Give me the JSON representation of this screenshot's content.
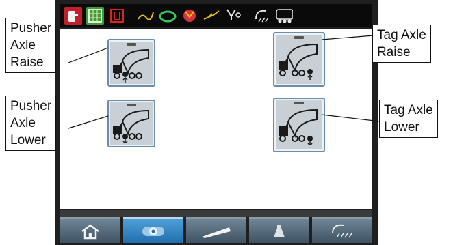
{
  "callouts": {
    "pusher_raise": [
      "Pusher",
      "Axle",
      "Raise"
    ],
    "pusher_lower": [
      "Pusher",
      "Axle",
      "Lower"
    ],
    "tag_raise": [
      "Tag Axle",
      "Raise"
    ],
    "tag_lower": [
      "Tag Axle",
      "Lower"
    ]
  },
  "topbar_icons": [
    "fuel-pump-icon",
    "grid-panel-icon",
    "tank-warning-icon",
    "drum-rotate-icon",
    "chute-icon",
    "valve-icon",
    "boom-icon",
    "water-valve-icon",
    "light-icon",
    "axle-status-icon"
  ],
  "bottom_tabs": [
    {
      "name": "home-icon",
      "active": false
    },
    {
      "name": "axle-icon",
      "active": true
    },
    {
      "name": "chute-icon",
      "active": false
    },
    {
      "name": "lamp-icon",
      "active": false
    },
    {
      "name": "work-light-icon",
      "active": false
    }
  ],
  "colors": {
    "bezel": "#1f1f1f",
    "active_tab": "#1f6fb0",
    "inactive_tab": "#4b5f6e",
    "button_border": "#6a8dab"
  }
}
